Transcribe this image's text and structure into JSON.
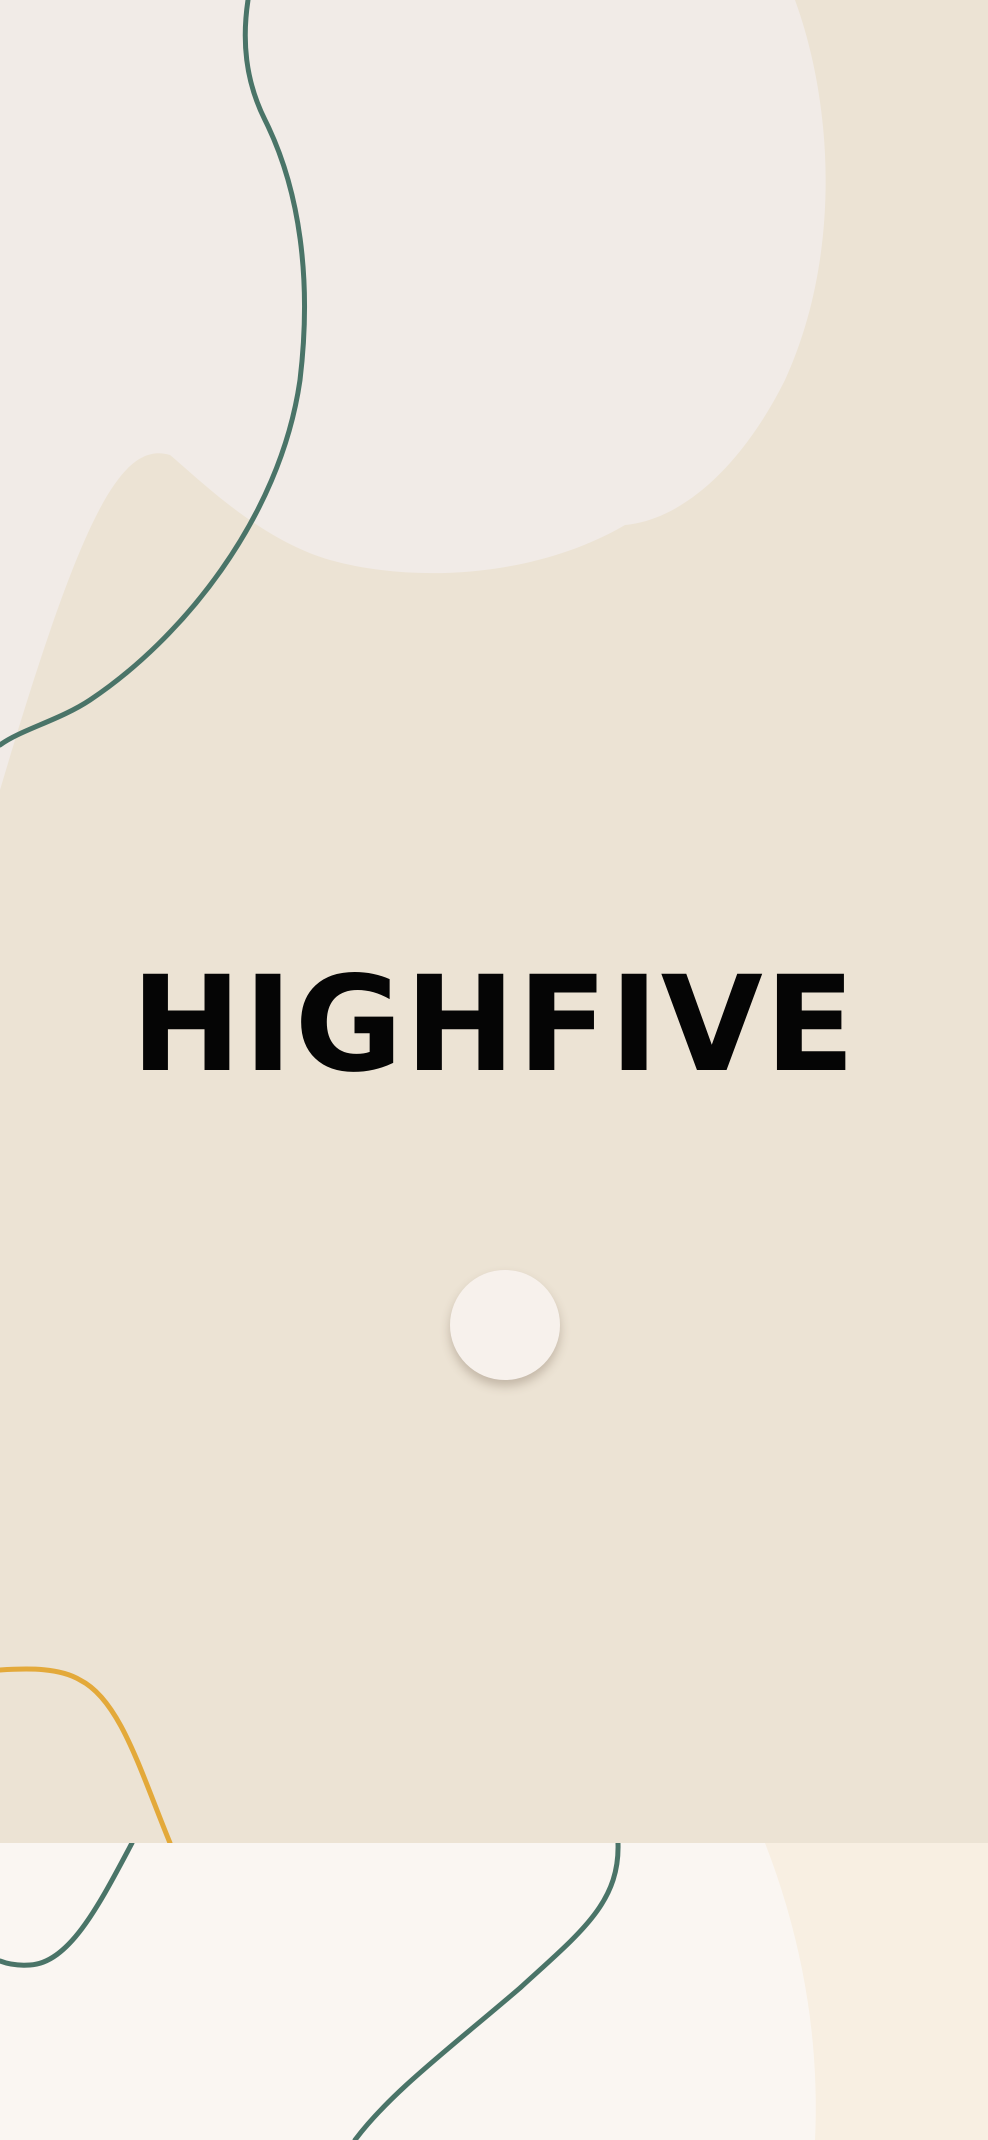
{
  "splash": {
    "brand_title": "HIGHFIVE",
    "loader": {
      "icon": "loading-dot"
    }
  },
  "colors": {
    "background": "#ece3d4",
    "blob_light": "#f1ebe7",
    "bottom_background": "#f8efe2",
    "bottom_blob": "#faf6f2",
    "teal_line": "#4a7468",
    "gold_line": "#e3a93a",
    "title": "#050505"
  }
}
